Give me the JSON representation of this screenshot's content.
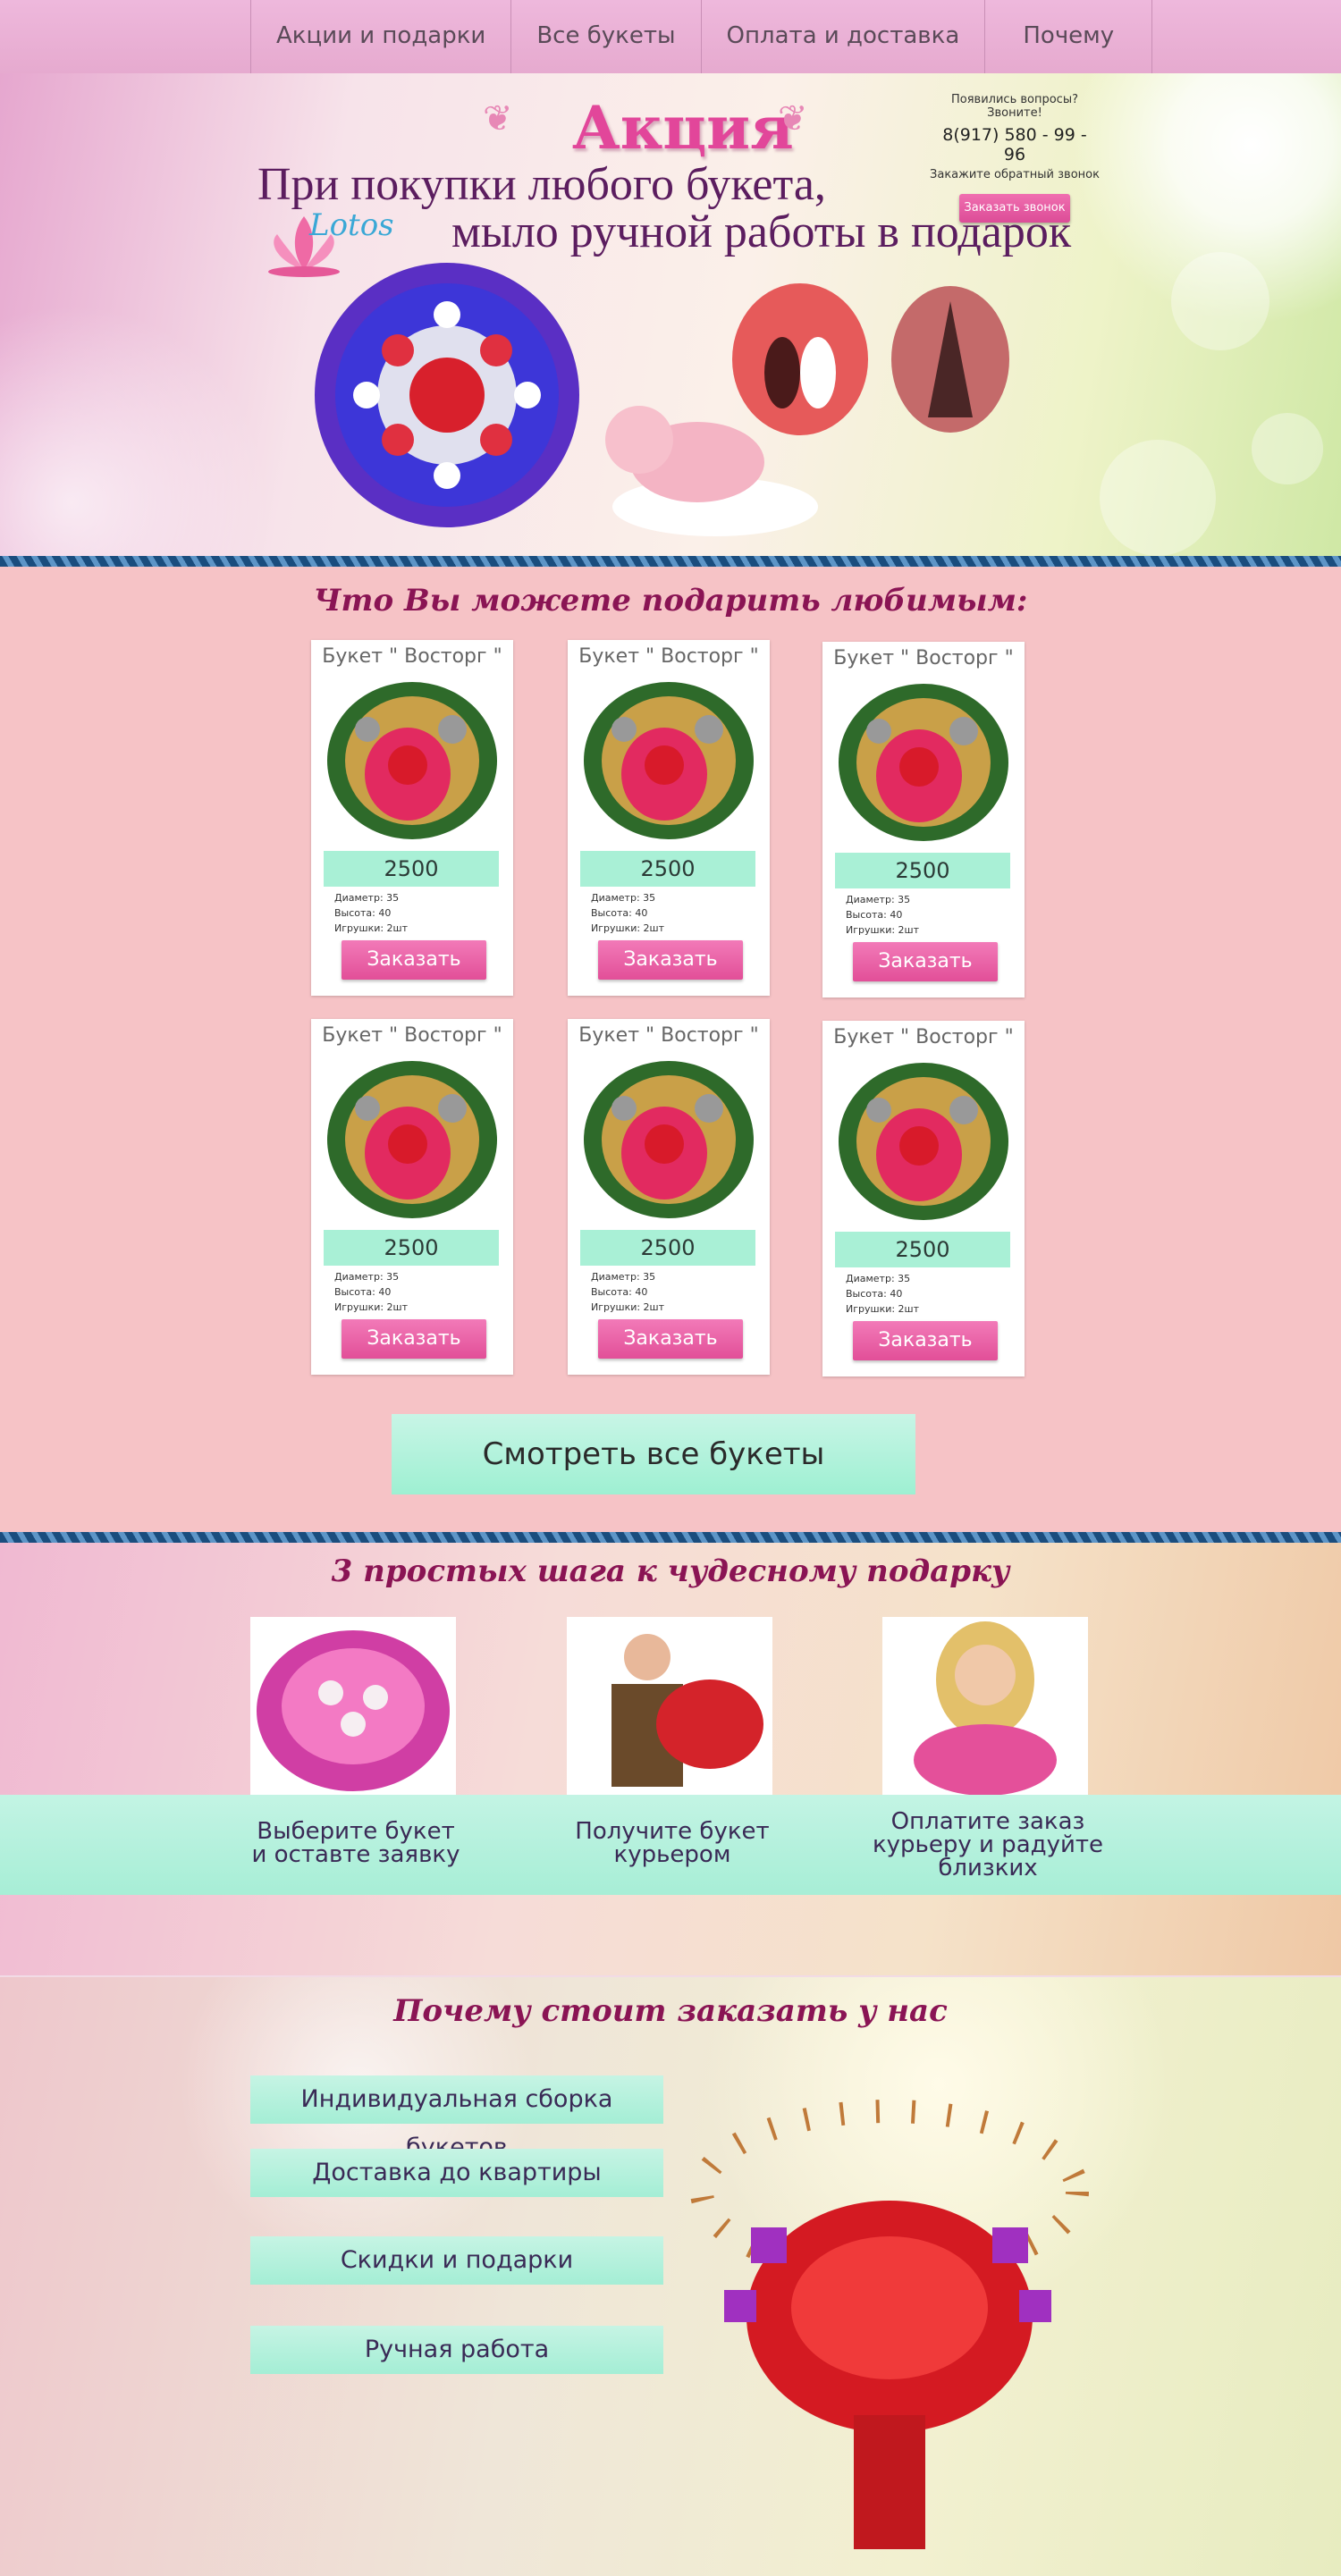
{
  "nav": {
    "items": [
      "Акции и подарки",
      "Все букеты",
      "Оплата и доставка",
      "Почему мы"
    ]
  },
  "hero": {
    "title": "Акция",
    "line1": "При покупки любого букета,",
    "line2": "мыло ручной работы в подарок",
    "logo": "Lotos",
    "contact": {
      "question": "Появились вопросы? Звоните!",
      "phone": "8(917) 580 - 99 - 96",
      "callback_text": "Закажите обратный звонок",
      "callback_button": "Заказать звонок"
    }
  },
  "products": {
    "title": "Что Вы можете подарить любимым:",
    "cards": [
      {
        "name": "Букет \" Восторг \"",
        "price": "2500",
        "diameter": "Диаметр: 35",
        "height": "Высота: 40",
        "toys": "Игрушки: 2шт",
        "button": "Заказать"
      },
      {
        "name": "Букет \" Восторг \"",
        "price": "2500",
        "diameter": "Диаметр: 35",
        "height": "Высота: 40",
        "toys": "Игрушки: 2шт",
        "button": "Заказать"
      },
      {
        "name": "Букет \" Восторг \"",
        "price": "2500",
        "diameter": "Диаметр: 35",
        "height": "Высота: 40",
        "toys": "Игрушки: 2шт",
        "button": "Заказать"
      },
      {
        "name": "Букет \" Восторг \"",
        "price": "2500",
        "diameter": "Диаметр: 35",
        "height": "Высота: 40",
        "toys": "Игрушки: 2шт",
        "button": "Заказать"
      },
      {
        "name": "Букет \" Восторг \"",
        "price": "2500",
        "diameter": "Диаметр: 35",
        "height": "Высота: 40",
        "toys": "Игрушки: 2шт",
        "button": "Заказать"
      },
      {
        "name": "Букет \" Восторг \"",
        "price": "2500",
        "diameter": "Диаметр: 35",
        "height": "Высота: 40",
        "toys": "Игрушки: 2шт",
        "button": "Заказать"
      }
    ],
    "all_button": "Смотреть все букеты"
  },
  "steps": {
    "title": "3 простых шага к чудесному подарку",
    "items": [
      {
        "line1": "Выберите букет",
        "line2": "и оставте заявку",
        "line3": ""
      },
      {
        "line1": "Получите букет",
        "line2": "курьером",
        "line3": ""
      },
      {
        "line1": "Оплатите заказ",
        "line2": "курьеру и радуйте",
        "line3": "близких"
      }
    ]
  },
  "why": {
    "title": "Почему стоит заказать у нас",
    "items": [
      "Индивидуальная сборка букетов",
      "Доставка до квартиры",
      "Скидки и подарки",
      "Ручная работа"
    ]
  },
  "colors": {
    "accent_pink": "#e24f98",
    "mint": "#a9f0d6",
    "title_plum": "#8a1454",
    "rope_blue": "#1a4d7e"
  }
}
